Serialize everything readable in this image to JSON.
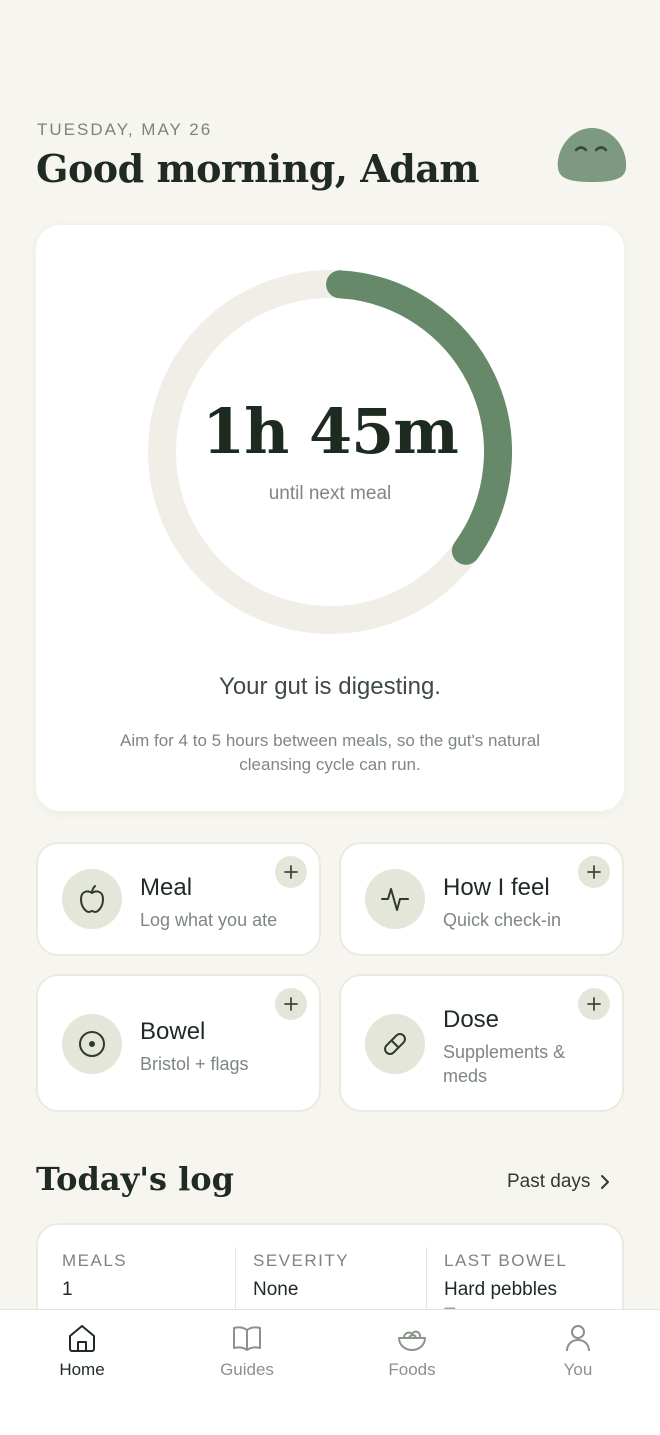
{
  "header": {
    "date": "TUESDAY, MAY 26",
    "greeting": "Good morning, Adam"
  },
  "timer": {
    "value": "1h 45m",
    "subtitle": "until next meal",
    "status": "Your gut is digesting.",
    "hint": "Aim for 4 to 5 hours between meals, so the gut's natural cleansing cycle can run.",
    "progress_fraction": 0.35,
    "colors": {
      "track": "#f0eee7",
      "progress": "#66896a"
    }
  },
  "actions": [
    {
      "title": "Meal",
      "subtitle": "Log what you ate",
      "icon": "apple-icon"
    },
    {
      "title": "How I feel",
      "subtitle": "Quick check-in",
      "icon": "pulse-icon"
    },
    {
      "title": "Bowel",
      "subtitle": "Bristol + flags",
      "icon": "target-icon"
    },
    {
      "title": "Dose",
      "subtitle": "Supplements & meds",
      "icon": "pill-icon"
    }
  ],
  "todays_log": {
    "title": "Today's log",
    "past_days_label": "Past days",
    "columns": [
      {
        "label": "MEALS",
        "value": "1"
      },
      {
        "label": "SEVERITY",
        "value": "None"
      },
      {
        "label": "LAST BOWEL",
        "value": "Hard pebbles",
        "extra": "Ty"
      }
    ]
  },
  "tabbar": {
    "tabs": [
      {
        "label": "Home",
        "icon": "home-icon",
        "active": true
      },
      {
        "label": "Guides",
        "icon": "book-icon",
        "active": false
      },
      {
        "label": "Foods",
        "icon": "bowl-icon",
        "active": false
      },
      {
        "label": "You",
        "icon": "user-icon",
        "active": false
      }
    ]
  },
  "colors": {
    "background": "#f6f5ef",
    "accent": "#66896a",
    "icon_bg": "#e3e6d9",
    "text_dark": "#1f2a22",
    "text_muted": "#7e877f"
  }
}
